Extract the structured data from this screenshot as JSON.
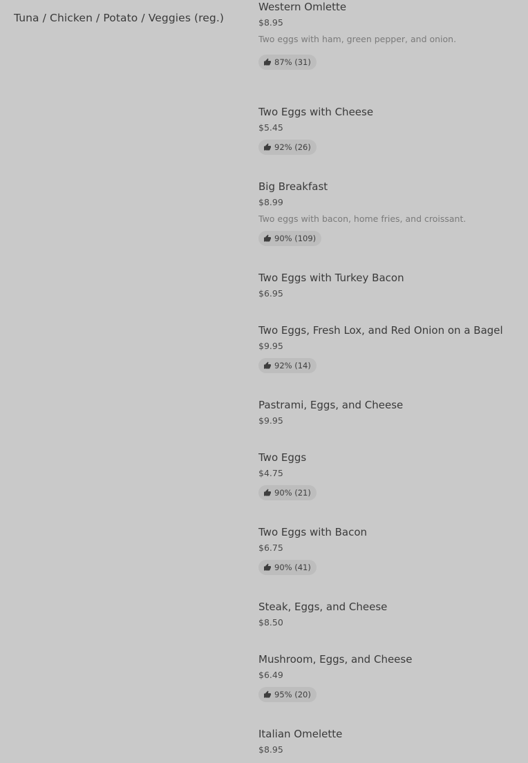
{
  "category": {
    "title": "Tuna / Chicken / Potato / Veggies (reg.)"
  },
  "items": [
    {
      "name": "Western Omlette",
      "price": "$8.95",
      "description": "Two eggs with ham, green pepper, and onion.",
      "rating": "87% (31)"
    },
    {
      "name": "Two Eggs with Cheese",
      "price": "$5.45",
      "description": "",
      "rating": "92% (26)"
    },
    {
      "name": "Big Breakfast",
      "price": "$8.99",
      "description": "Two eggs with bacon, home fries, and croissant.",
      "rating": "90% (109)"
    },
    {
      "name": "Two Eggs with Turkey Bacon",
      "price": "$6.95",
      "description": "",
      "rating": ""
    },
    {
      "name": "Two Eggs, Fresh Lox, and Red Onion on a Bagel",
      "price": "$9.95",
      "description": "",
      "rating": "92% (14)"
    },
    {
      "name": "Pastrami, Eggs, and Cheese",
      "price": "$9.95",
      "description": "",
      "rating": ""
    },
    {
      "name": "Two Eggs",
      "price": "$4.75",
      "description": "",
      "rating": "90% (21)"
    },
    {
      "name": "Two Eggs with Bacon",
      "price": "$6.75",
      "description": "",
      "rating": "90% (41)"
    },
    {
      "name": "Steak, Eggs, and Cheese",
      "price": "$8.50",
      "description": "",
      "rating": ""
    },
    {
      "name": "Mushroom, Eggs, and Cheese",
      "price": "$6.49",
      "description": "",
      "rating": "95% (20)"
    },
    {
      "name": "Italian Omelette",
      "price": "$8.95",
      "description": "",
      "rating": ""
    }
  ],
  "icons": {
    "rating": "thumbs-up-icon"
  }
}
